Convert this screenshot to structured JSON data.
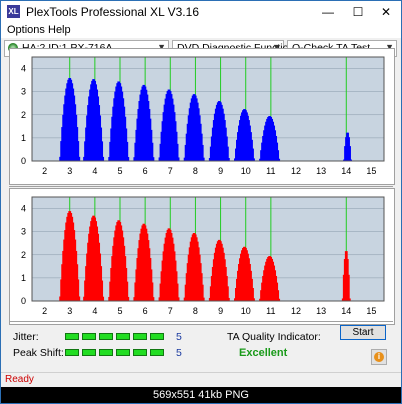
{
  "window": {
    "title": "PlexTools Professional XL V3.16",
    "app_icon_text": "XL",
    "minimize": "—",
    "maximize": "☐",
    "close": "✕"
  },
  "menu": [
    "Options",
    "Help"
  ],
  "toolbar": {
    "drive": "HA:2 ID:1  PX-716A",
    "function": "DVD Diagnostic Functions",
    "test": "Q-Check TA Test"
  },
  "chart_data": [
    {
      "type": "bar",
      "name": "Jitter distribution",
      "color": "#0000ff",
      "xlim": [
        1.5,
        15.5
      ],
      "ylim": [
        0,
        4.5
      ],
      "x_ticks": [
        2,
        3,
        4,
        5,
        6,
        7,
        8,
        9,
        10,
        11,
        12,
        13,
        14,
        15
      ],
      "y_ticks": [
        0,
        1,
        2,
        3,
        4
      ],
      "peaks": [
        {
          "center": 3.0,
          "height": 3.6
        },
        {
          "center": 3.95,
          "height": 3.55
        },
        {
          "center": 4.95,
          "height": 3.45
        },
        {
          "center": 5.95,
          "height": 3.3
        },
        {
          "center": 6.95,
          "height": 3.1
        },
        {
          "center": 7.95,
          "height": 2.9
        },
        {
          "center": 8.95,
          "height": 2.6
        },
        {
          "center": 9.95,
          "height": 2.25
        },
        {
          "center": 10.95,
          "height": 1.95
        },
        {
          "center": 14.05,
          "height": 1.25
        }
      ],
      "green_lines": [
        3,
        4,
        5,
        6,
        7,
        8,
        9,
        10,
        11,
        14
      ]
    },
    {
      "type": "bar",
      "name": "Peak shift distribution",
      "color": "#ff0000",
      "xlim": [
        1.5,
        15.5
      ],
      "ylim": [
        0,
        4.5
      ],
      "x_ticks": [
        2,
        3,
        4,
        5,
        6,
        7,
        8,
        9,
        10,
        11,
        12,
        13,
        14,
        15
      ],
      "y_ticks": [
        0,
        1,
        2,
        3,
        4
      ],
      "peaks": [
        {
          "center": 3.0,
          "height": 3.9
        },
        {
          "center": 3.95,
          "height": 3.7
        },
        {
          "center": 4.95,
          "height": 3.5
        },
        {
          "center": 5.95,
          "height": 3.35
        },
        {
          "center": 6.95,
          "height": 3.15
        },
        {
          "center": 7.95,
          "height": 2.95
        },
        {
          "center": 8.95,
          "height": 2.65
        },
        {
          "center": 9.95,
          "height": 2.35
        },
        {
          "center": 10.95,
          "height": 1.95
        },
        {
          "center": 14.0,
          "height": 2.2
        }
      ],
      "green_lines": [
        3,
        4,
        5,
        6,
        7,
        8,
        9,
        10,
        11,
        14
      ]
    }
  ],
  "metrics": {
    "jitter_label": "Jitter:",
    "jitter_value": "5",
    "jitter_level": 6,
    "peak_label": "Peak Shift:",
    "peak_value": "5",
    "peak_level": 6,
    "ta_label": "TA Quality Indicator:",
    "ta_value": "Excellent"
  },
  "buttons": {
    "start": "Start",
    "info_icon": "i"
  },
  "status": "Ready",
  "caption": "569x551  41kb  PNG"
}
